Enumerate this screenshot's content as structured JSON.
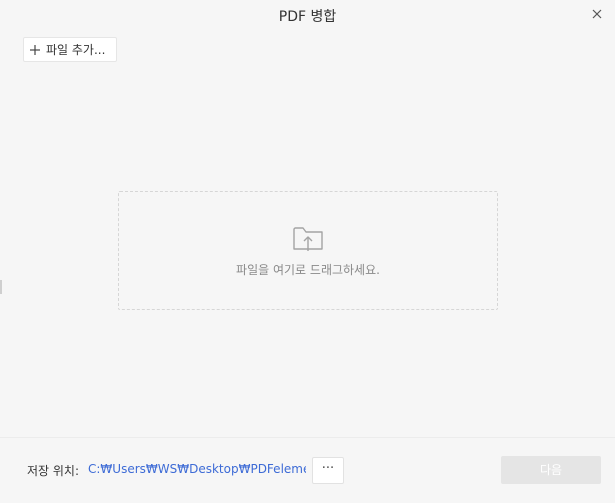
{
  "window": {
    "title": "PDF 병합"
  },
  "toolbar": {
    "add_file_label": "파일 추가..."
  },
  "drop_zone": {
    "hint": "파일을 여기로 드래그하세요."
  },
  "footer": {
    "save_location_label": "저장 위치:",
    "save_path": "C:₩Users₩WS₩Desktop₩PDFelement ...",
    "browse_label": "···",
    "next_label": "다음"
  },
  "colors": {
    "link": "#3d6bd6",
    "disabled_button": "#e5e5e5",
    "background": "#f6f6f6"
  },
  "icons": {
    "close": "close-icon",
    "add": "plus-icon",
    "drop": "folder-upload-icon"
  }
}
